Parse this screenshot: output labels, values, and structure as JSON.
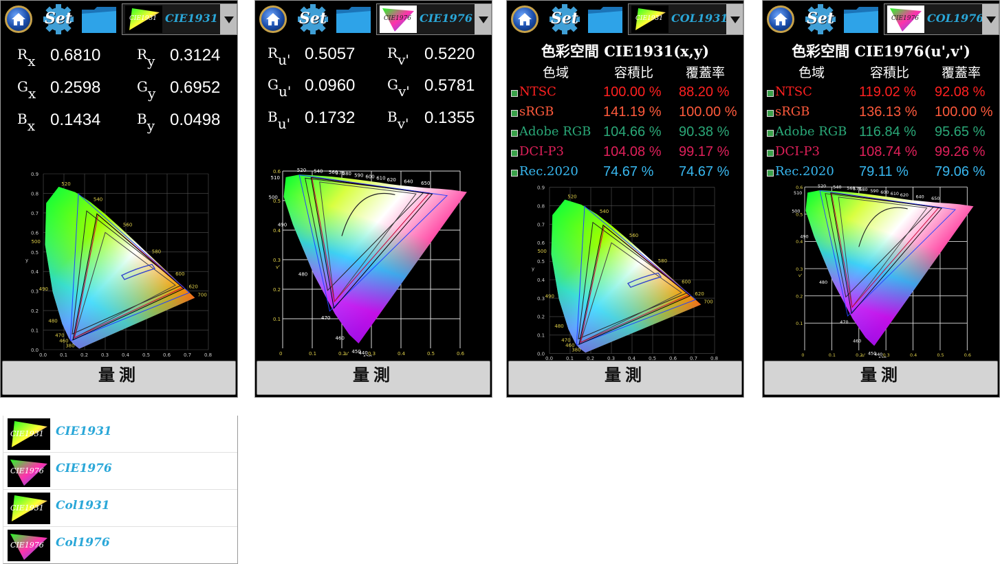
{
  "toolbar": {
    "set_label": "Set"
  },
  "panels": [
    {
      "mode": "CIE1931",
      "thumb": "CIE1931",
      "coords": [
        {
          "label": "R",
          "sub": "x",
          "value": "0.6810"
        },
        {
          "label": "R",
          "sub": "y",
          "value": "0.3124"
        },
        {
          "label": "G",
          "sub": "x",
          "value": "0.2598"
        },
        {
          "label": "G",
          "sub": "y",
          "value": "0.6952"
        },
        {
          "label": "B",
          "sub": "x",
          "value": "0.1434"
        },
        {
          "label": "B",
          "sub": "y",
          "value": "0.0498"
        }
      ]
    },
    {
      "mode": "CIE1976",
      "thumb": "CIE1976",
      "coords": [
        {
          "label": "R",
          "sub": "u'",
          "value": "0.5057"
        },
        {
          "label": "R",
          "sub": "v'",
          "value": "0.5220"
        },
        {
          "label": "G",
          "sub": "u'",
          "value": "0.0960"
        },
        {
          "label": "G",
          "sub": "v'",
          "value": "0.5781"
        },
        {
          "label": "B",
          "sub": "u'",
          "value": "0.1732"
        },
        {
          "label": "B",
          "sub": "v'",
          "value": "0.1355"
        }
      ]
    },
    {
      "mode": "COL1931",
      "thumb": "CIE1931",
      "title": "色彩空間 CIE1931(x,y)",
      "headers": [
        "色域",
        "容積比",
        "覆蓋率"
      ],
      "rows": [
        {
          "name": "NTSC",
          "ratio": "100.00 %",
          "cover": "88.20 %",
          "color": "#ff2020"
        },
        {
          "name": "sRGB",
          "ratio": "141.19 %",
          "cover": "100.00 %",
          "color": "#ff5a3c"
        },
        {
          "name": "Adobe RGB",
          "ratio": "104.66 %",
          "cover": "90.38 %",
          "color": "#2aa878"
        },
        {
          "name": "DCI-P3",
          "ratio": "104.08 %",
          "cover": "99.17 %",
          "color": "#e0205a"
        },
        {
          "name": "Rec.2020",
          "ratio": "74.67 %",
          "cover": "74.67 %",
          "color": "#38b8f0"
        }
      ]
    },
    {
      "mode": "COL1976",
      "thumb": "CIE1976",
      "title": "色彩空間 CIE1976(u',v')",
      "headers": [
        "色域",
        "容積比",
        "覆蓋率"
      ],
      "rows": [
        {
          "name": "NTSC",
          "ratio": "119.02 %",
          "cover": "92.08 %",
          "color": "#ff2020"
        },
        {
          "name": "sRGB",
          "ratio": "136.13 %",
          "cover": "100.00 %",
          "color": "#ff5a3c"
        },
        {
          "name": "Adobe RGB",
          "ratio": "116.84 %",
          "cover": "95.65 %",
          "color": "#2aa878"
        },
        {
          "name": "DCI-P3",
          "ratio": "108.74 %",
          "cover": "99.26 %",
          "color": "#e0205a"
        },
        {
          "name": "Rec.2020",
          "ratio": "79.11 %",
          "cover": "79.06 %",
          "color": "#38b8f0"
        }
      ]
    }
  ],
  "measure_label": "量測",
  "dropdown": [
    {
      "label": "CIE1931",
      "thumb": "CIE1931"
    },
    {
      "label": "CIE1976",
      "thumb": "CIE1976"
    },
    {
      "label": "Col1931",
      "thumb": "CIE1931"
    },
    {
      "label": "Col1976",
      "thumb": "CIE1976"
    }
  ],
  "cie1931_axis": {
    "x_ticks": [
      "0.0",
      "0.1",
      "0.2",
      "0.3",
      "0.4",
      "0.5",
      "0.6",
      "0.7",
      "0.8"
    ],
    "y_ticks": [
      "0.0",
      "0.1",
      "0.2",
      "0.3",
      "0.4",
      "0.5",
      "0.6",
      "0.7",
      "0.8",
      "0.9"
    ],
    "x_label": "x",
    "y_label": "y",
    "wavelengths": [
      "520",
      "540",
      "560",
      "580",
      "600",
      "620",
      "700",
      "500",
      "490",
      "480",
      "470",
      "460",
      "380"
    ]
  },
  "cie1976_axis": {
    "x_ticks": [
      "0",
      "0.1",
      "0.2",
      "0.3",
      "0.4",
      "0.5",
      "0.6"
    ],
    "y_ticks": [
      "0.1",
      "0.2",
      "0.3",
      "0.4",
      "0.5",
      "0.6"
    ],
    "x_label": "u'",
    "y_label": "v'",
    "wavelengths": [
      "520",
      "540",
      "560",
      "570",
      "580",
      "590",
      "600",
      "610",
      "620",
      "640",
      "650",
      "510",
      "500",
      "490",
      "480",
      "470",
      "460",
      "450",
      "440",
      "420"
    ]
  }
}
